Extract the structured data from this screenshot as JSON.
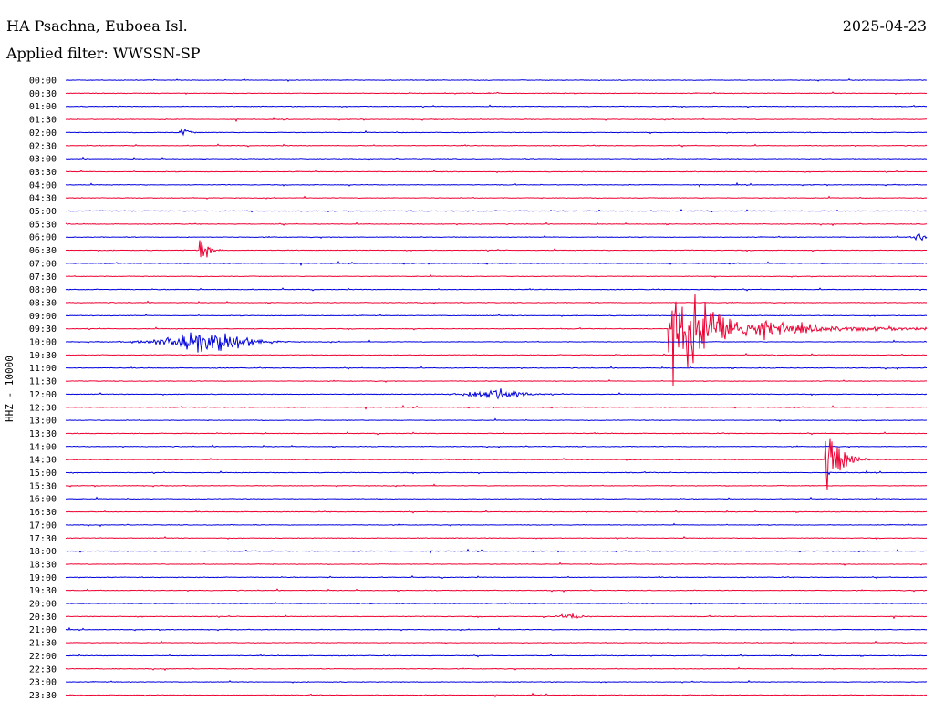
{
  "header": {
    "station": "HA Psachna, Euboea Isl.",
    "date": "2025-04-23",
    "filter": "Applied filter: WWSSN-SP"
  },
  "colors": {
    "even_hour": "#0000dd",
    "half_hour": "#ee0033",
    "background": "#ffffff"
  },
  "chart_data": {
    "type": "line",
    "ylabel": "HHZ - 10000",
    "rows": [
      "00:00",
      "00:30",
      "01:00",
      "01:30",
      "02:00",
      "02:30",
      "03:00",
      "03:30",
      "04:00",
      "04:30",
      "05:00",
      "05:30",
      "06:00",
      "06:30",
      "07:00",
      "07:30",
      "08:00",
      "08:30",
      "09:00",
      "09:30",
      "10:00",
      "10:30",
      "11:00",
      "11:30",
      "12:00",
      "12:30",
      "13:00",
      "13:30",
      "14:00",
      "14:30",
      "15:00",
      "15:30",
      "16:00",
      "16:30",
      "17:00",
      "17:30",
      "18:00",
      "18:30",
      "19:00",
      "19:30",
      "20:00",
      "20:30",
      "21:00",
      "21:30",
      "22:00",
      "22:30",
      "23:00",
      "23:30"
    ],
    "minutes_per_row": 30,
    "x_range_minutes": [
      0,
      30
    ],
    "events": [
      {
        "row": "02:00",
        "minute": 4.0,
        "amplitude": 1.0,
        "duration_min": 0.6,
        "kind": "spike"
      },
      {
        "row": "06:30",
        "minute": 4.7,
        "amplitude": 2.0,
        "duration_min": 0.8,
        "kind": "spike"
      },
      {
        "row": "10:00",
        "minute": 4.6,
        "amplitude": 1.2,
        "duration_min": 3.0,
        "kind": "burst"
      },
      {
        "row": "12:00",
        "minute": 14.8,
        "amplitude": 0.6,
        "duration_min": 2.0,
        "kind": "burst"
      },
      {
        "row": "09:30",
        "minute": 21.0,
        "amplitude": 5.5,
        "duration_min": 9.0,
        "kind": "quake"
      },
      {
        "row": "14:30",
        "minute": 26.5,
        "amplitude": 5.0,
        "duration_min": 1.5,
        "kind": "spike"
      },
      {
        "row": "20:30",
        "minute": 17.5,
        "amplitude": 0.3,
        "duration_min": 0.8,
        "kind": "burst"
      },
      {
        "row": "06:00",
        "minute": 29.7,
        "amplitude": 0.4,
        "duration_min": 0.4,
        "kind": "burst"
      }
    ],
    "grid": false
  }
}
